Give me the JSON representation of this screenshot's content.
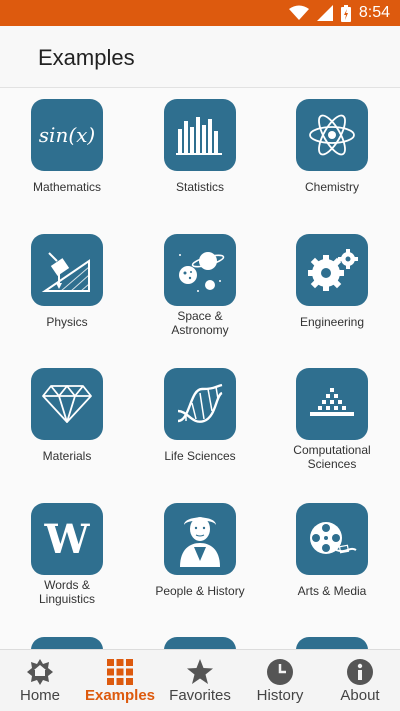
{
  "status_bar": {
    "time": "8:54"
  },
  "header": {
    "title": "Examples"
  },
  "grid": {
    "tiles": [
      {
        "label": "Mathematics",
        "icon": "sin-x-icon",
        "icon_text": "sin(x)"
      },
      {
        "label": "Statistics",
        "icon": "bar-chart-icon"
      },
      {
        "label": "Chemistry",
        "icon": "atom-icon"
      },
      {
        "label": "Physics",
        "icon": "inclined-plane-icon"
      },
      {
        "label": "Space & Astronomy",
        "icon": "planet-icon"
      },
      {
        "label": "Engineering",
        "icon": "gears-icon"
      },
      {
        "label": "Materials",
        "icon": "diamond-icon"
      },
      {
        "label": "Life Sciences",
        "icon": "dna-icon"
      },
      {
        "label": "Computational Sciences",
        "icon": "pixel-pyramid-icon"
      },
      {
        "label": "Words & Linguistics",
        "icon": "letter-w-icon",
        "icon_text": "W"
      },
      {
        "label": "People & History",
        "icon": "portrait-icon"
      },
      {
        "label": "Arts & Media",
        "icon": "film-reel-icon"
      }
    ]
  },
  "bottom_nav": {
    "items": [
      {
        "label": "Home",
        "icon": "home-star-icon",
        "active": false
      },
      {
        "label": "Examples",
        "icon": "grid-icon",
        "active": true
      },
      {
        "label": "Favorites",
        "icon": "star-icon",
        "active": false
      },
      {
        "label": "History",
        "icon": "clock-icon",
        "active": false
      },
      {
        "label": "About",
        "icon": "info-icon",
        "active": false
      }
    ]
  },
  "colors": {
    "status_bar": "#dd5a0e",
    "tile_bg": "#2f6f8f",
    "active_nav": "#dd5a0e"
  }
}
